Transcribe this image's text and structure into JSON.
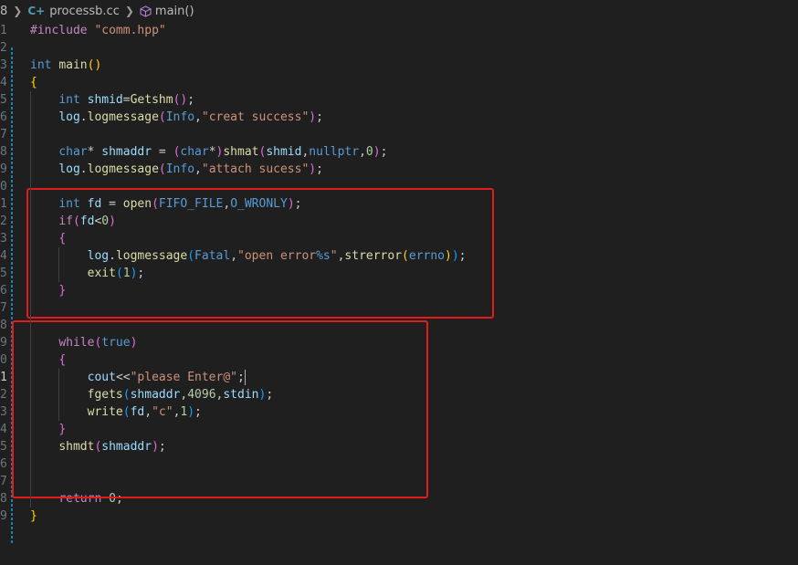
{
  "breadcrumb": {
    "lead_fragment": "8",
    "file_name": "processb.cc",
    "symbol": "main()"
  },
  "colors": {
    "background": "#1f1f1f",
    "highlight_box": "#e21b1b",
    "scm_modified": "#1b81a8"
  },
  "lines": [
    {
      "n": "1",
      "tokens": [
        {
          "t": "#include",
          "c": "pp"
        },
        {
          "t": " \"comm.hpp\"",
          "c": "str"
        }
      ]
    },
    {
      "n": "2",
      "tokens": []
    },
    {
      "n": "3",
      "tokens": [
        {
          "t": "int",
          "c": "type"
        },
        {
          "t": " ",
          "c": "plain"
        },
        {
          "t": "main",
          "c": "fn"
        },
        {
          "t": "()",
          "c": "br1"
        }
      ]
    },
    {
      "n": "4",
      "tokens": [
        {
          "t": "{",
          "c": "br1"
        }
      ]
    },
    {
      "n": "5",
      "tokens": [
        {
          "t": "    ",
          "c": "plain"
        },
        {
          "t": "int",
          "c": "type"
        },
        {
          "t": " ",
          "c": "plain"
        },
        {
          "t": "shmid",
          "c": "var"
        },
        {
          "t": "=",
          "c": "plain"
        },
        {
          "t": "Getshm",
          "c": "fn"
        },
        {
          "t": "()",
          "c": "br2"
        },
        {
          "t": ";",
          "c": "plain"
        }
      ]
    },
    {
      "n": "6",
      "tokens": [
        {
          "t": "    ",
          "c": "plain"
        },
        {
          "t": "log",
          "c": "var"
        },
        {
          "t": ".",
          "c": "plain"
        },
        {
          "t": "logmessage",
          "c": "fn"
        },
        {
          "t": "(",
          "c": "br2"
        },
        {
          "t": "Info",
          "c": "type"
        },
        {
          "t": ",",
          "c": "plain"
        },
        {
          "t": "\"creat success\"",
          "c": "str"
        },
        {
          "t": ")",
          "c": "br2"
        },
        {
          "t": ";",
          "c": "plain"
        }
      ]
    },
    {
      "n": "7",
      "tokens": []
    },
    {
      "n": "8",
      "tokens": [
        {
          "t": "    ",
          "c": "plain"
        },
        {
          "t": "char",
          "c": "type"
        },
        {
          "t": "* ",
          "c": "plain"
        },
        {
          "t": "shmaddr",
          "c": "var"
        },
        {
          "t": " = ",
          "c": "plain"
        },
        {
          "t": "(",
          "c": "br2"
        },
        {
          "t": "char",
          "c": "type"
        },
        {
          "t": "*",
          "c": "plain"
        },
        {
          "t": ")",
          "c": "br2"
        },
        {
          "t": "shmat",
          "c": "fn"
        },
        {
          "t": "(",
          "c": "br2"
        },
        {
          "t": "shmid",
          "c": "var"
        },
        {
          "t": ",",
          "c": "plain"
        },
        {
          "t": "nullptr",
          "c": "type"
        },
        {
          "t": ",",
          "c": "plain"
        },
        {
          "t": "0",
          "c": "num"
        },
        {
          "t": ")",
          "c": "br2"
        },
        {
          "t": ";",
          "c": "plain"
        }
      ]
    },
    {
      "n": "9",
      "tokens": [
        {
          "t": "    ",
          "c": "plain"
        },
        {
          "t": "log",
          "c": "var"
        },
        {
          "t": ".",
          "c": "plain"
        },
        {
          "t": "logmessage",
          "c": "fn"
        },
        {
          "t": "(",
          "c": "br2"
        },
        {
          "t": "Info",
          "c": "type"
        },
        {
          "t": ",",
          "c": "plain"
        },
        {
          "t": "\"attach sucess\"",
          "c": "str"
        },
        {
          "t": ")",
          "c": "br2"
        },
        {
          "t": ";",
          "c": "plain"
        }
      ]
    },
    {
      "n": "0",
      "tokens": []
    },
    {
      "n": "1",
      "tokens": [
        {
          "t": "    ",
          "c": "plain"
        },
        {
          "t": "int",
          "c": "type"
        },
        {
          "t": " ",
          "c": "plain"
        },
        {
          "t": "fd",
          "c": "var"
        },
        {
          "t": " = ",
          "c": "plain"
        },
        {
          "t": "open",
          "c": "fn"
        },
        {
          "t": "(",
          "c": "br2"
        },
        {
          "t": "FIFO_FILE",
          "c": "type"
        },
        {
          "t": ",",
          "c": "plain"
        },
        {
          "t": "O_WRONLY",
          "c": "type"
        },
        {
          "t": ")",
          "c": "br2"
        },
        {
          "t": ";",
          "c": "plain"
        }
      ]
    },
    {
      "n": "2",
      "tokens": [
        {
          "t": "    ",
          "c": "plain"
        },
        {
          "t": "if",
          "c": "kw"
        },
        {
          "t": "(",
          "c": "br2"
        },
        {
          "t": "fd",
          "c": "var"
        },
        {
          "t": "<",
          "c": "plain"
        },
        {
          "t": "0",
          "c": "num"
        },
        {
          "t": ")",
          "c": "br2"
        }
      ]
    },
    {
      "n": "3",
      "tokens": [
        {
          "t": "    ",
          "c": "plain"
        },
        {
          "t": "{",
          "c": "br2"
        }
      ]
    },
    {
      "n": "4",
      "tokens": [
        {
          "t": "        ",
          "c": "plain"
        },
        {
          "t": "log",
          "c": "var"
        },
        {
          "t": ".",
          "c": "plain"
        },
        {
          "t": "logmessage",
          "c": "fn"
        },
        {
          "t": "(",
          "c": "br3"
        },
        {
          "t": "Fatal",
          "c": "type"
        },
        {
          "t": ",",
          "c": "plain"
        },
        {
          "t": "\"open error",
          "c": "str"
        },
        {
          "t": "%s",
          "c": "type"
        },
        {
          "t": "\"",
          "c": "str"
        },
        {
          "t": ",",
          "c": "plain"
        },
        {
          "t": "strerror",
          "c": "fn"
        },
        {
          "t": "(",
          "c": "br1"
        },
        {
          "t": "errno",
          "c": "type"
        },
        {
          "t": ")",
          "c": "br1"
        },
        {
          "t": ")",
          "c": "br3"
        },
        {
          "t": ";",
          "c": "plain"
        }
      ]
    },
    {
      "n": "5",
      "tokens": [
        {
          "t": "        ",
          "c": "plain"
        },
        {
          "t": "exit",
          "c": "fn"
        },
        {
          "t": "(",
          "c": "br3"
        },
        {
          "t": "1",
          "c": "num"
        },
        {
          "t": ")",
          "c": "br3"
        },
        {
          "t": ";",
          "c": "plain"
        }
      ]
    },
    {
      "n": "6",
      "tokens": [
        {
          "t": "    ",
          "c": "plain"
        },
        {
          "t": "}",
          "c": "br2"
        }
      ]
    },
    {
      "n": "7",
      "tokens": []
    },
    {
      "n": "8",
      "tokens": []
    },
    {
      "n": "9",
      "tokens": [
        {
          "t": "    ",
          "c": "plain"
        },
        {
          "t": "while",
          "c": "kw"
        },
        {
          "t": "(",
          "c": "br2"
        },
        {
          "t": "true",
          "c": "type"
        },
        {
          "t": ")",
          "c": "br2"
        }
      ]
    },
    {
      "n": "0",
      "tokens": [
        {
          "t": "    ",
          "c": "plain"
        },
        {
          "t": "{",
          "c": "br2"
        }
      ]
    },
    {
      "n": "1",
      "active": true,
      "tokens": [
        {
          "t": "        ",
          "c": "plain"
        },
        {
          "t": "cout",
          "c": "var"
        },
        {
          "t": "<<",
          "c": "plain"
        },
        {
          "t": "\"please Enter@\"",
          "c": "str"
        },
        {
          "t": ";",
          "c": "plain"
        }
      ]
    },
    {
      "n": "2",
      "tokens": [
        {
          "t": "        ",
          "c": "plain"
        },
        {
          "t": "fgets",
          "c": "fn"
        },
        {
          "t": "(",
          "c": "br3"
        },
        {
          "t": "shmaddr",
          "c": "var"
        },
        {
          "t": ",",
          "c": "plain"
        },
        {
          "t": "4096",
          "c": "num"
        },
        {
          "t": ",",
          "c": "plain"
        },
        {
          "t": "stdin",
          "c": "var"
        },
        {
          "t": ")",
          "c": "br3"
        },
        {
          "t": ";",
          "c": "plain"
        }
      ]
    },
    {
      "n": "3",
      "tokens": [
        {
          "t": "        ",
          "c": "plain"
        },
        {
          "t": "write",
          "c": "fn"
        },
        {
          "t": "(",
          "c": "br3"
        },
        {
          "t": "fd",
          "c": "var"
        },
        {
          "t": ",",
          "c": "plain"
        },
        {
          "t": "\"c\"",
          "c": "str"
        },
        {
          "t": ",",
          "c": "plain"
        },
        {
          "t": "1",
          "c": "num"
        },
        {
          "t": ")",
          "c": "br3"
        },
        {
          "t": ";",
          "c": "plain"
        }
      ]
    },
    {
      "n": "4",
      "tokens": [
        {
          "t": "    ",
          "c": "plain"
        },
        {
          "t": "}",
          "c": "br2"
        }
      ]
    },
    {
      "n": "5",
      "tokens": [
        {
          "t": "    ",
          "c": "plain"
        },
        {
          "t": "shmdt",
          "c": "fn"
        },
        {
          "t": "(",
          "c": "br2"
        },
        {
          "t": "shmaddr",
          "c": "var"
        },
        {
          "t": ")",
          "c": "br2"
        },
        {
          "t": ";",
          "c": "plain"
        }
      ]
    },
    {
      "n": "6",
      "tokens": []
    },
    {
      "n": "7",
      "tokens": []
    },
    {
      "n": "8",
      "tokens": [
        {
          "t": "    ",
          "c": "plain"
        },
        {
          "t": "return",
          "c": "kw"
        },
        {
          "t": " ",
          "c": "plain"
        },
        {
          "t": "0",
          "c": "num"
        },
        {
          "t": ";",
          "c": "plain"
        }
      ]
    },
    {
      "n": "9",
      "tokens": [
        {
          "t": "}",
          "c": "br1"
        }
      ]
    }
  ]
}
